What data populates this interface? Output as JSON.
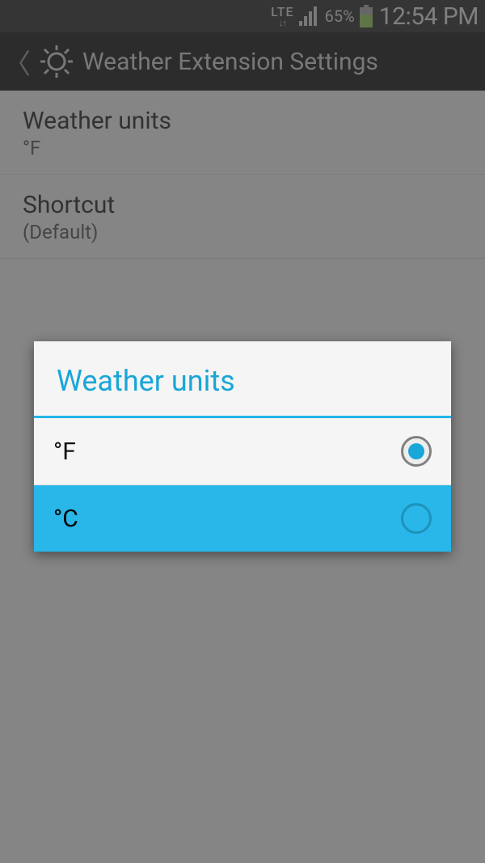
{
  "status": {
    "network": "LTE",
    "battery_pct": "65%",
    "time": "12:54 PM"
  },
  "header": {
    "title": "Weather Extension Settings"
  },
  "settings": {
    "units": {
      "title": "Weather units",
      "value": "°F"
    },
    "shortcut": {
      "title": "Shortcut",
      "value": "(Default)"
    }
  },
  "dialog": {
    "title": "Weather units",
    "options": [
      {
        "label": "°F",
        "selected": true,
        "highlight": false
      },
      {
        "label": "°C",
        "selected": false,
        "highlight": true
      }
    ]
  }
}
